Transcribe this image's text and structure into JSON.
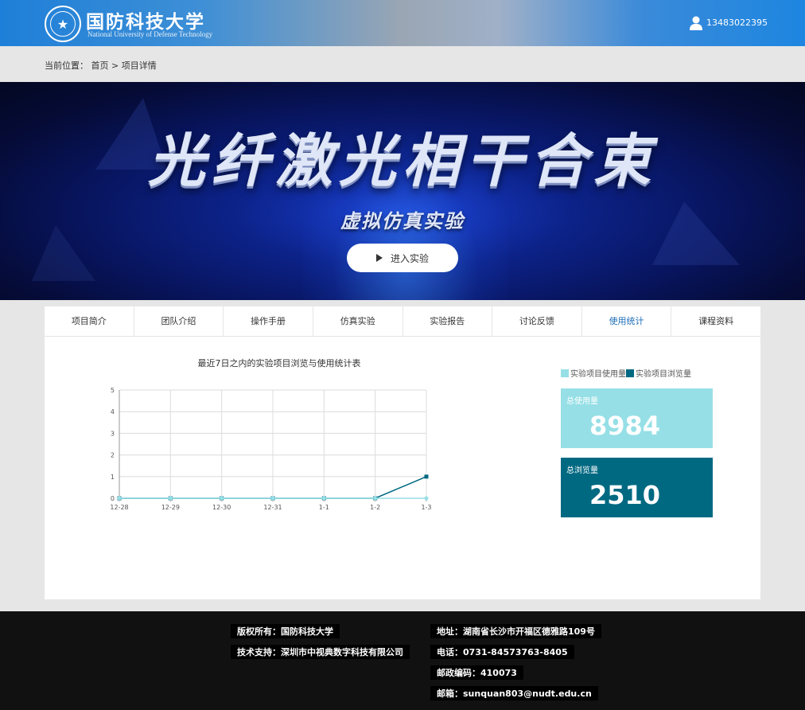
{
  "header": {
    "logo_cn": "国防科技大学",
    "logo_en": "National University of Defense Technology",
    "user_phone": "13483022395",
    "colors": {
      "brand_blue": "#1e7fd8"
    }
  },
  "breadcrumb": {
    "label": "当前位置：",
    "home": "首页",
    "current": "> 项目详情"
  },
  "banner": {
    "title": "光纤激光相干合束",
    "subtitle": "虚拟仿真实验",
    "enter_button": "进入实验"
  },
  "tabs": [
    {
      "label": "项目简介",
      "active": false
    },
    {
      "label": "团队介绍",
      "active": false
    },
    {
      "label": "操作手册",
      "active": false
    },
    {
      "label": "仿真实验",
      "active": false
    },
    {
      "label": "实验报告",
      "active": false
    },
    {
      "label": "讨论反馈",
      "active": false
    },
    {
      "label": "使用统计",
      "active": true
    },
    {
      "label": "课程资料",
      "active": false
    }
  ],
  "stats": {
    "total_usage_label": "总使用量",
    "total_usage_value": "8984",
    "total_views_label": "总浏览量",
    "total_views_value": "2510"
  },
  "chart_data": {
    "type": "line",
    "title": "最近7日之内的实验项目浏览与使用统计表",
    "categories": [
      "12-28",
      "12-29",
      "12-30",
      "12-31",
      "1-1",
      "1-2",
      "1-3"
    ],
    "series": [
      {
        "name": "实验项目使用量",
        "values": [
          0,
          0,
          0,
          0,
          0,
          0,
          0
        ],
        "color": "#96dfe6"
      },
      {
        "name": "实验项目浏览量",
        "values": [
          0,
          0,
          0,
          0,
          0,
          0,
          1
        ],
        "color": "#006982"
      }
    ],
    "ylim": [
      0,
      5
    ],
    "yticks": [
      0,
      1,
      2,
      3,
      4,
      5
    ],
    "grid": true,
    "legend": "top-right"
  },
  "footer": {
    "copyright": "版权所有：国防科技大学",
    "support": "技术支持：深圳市中视典数字科技有限公司",
    "address": "地址：湖南省长沙市开福区德雅路109号",
    "phone": "电话：0731-84573763-8405",
    "postcode": "邮政编码：410073",
    "email": "邮箱：sunquan803@nudt.edu.cn"
  }
}
